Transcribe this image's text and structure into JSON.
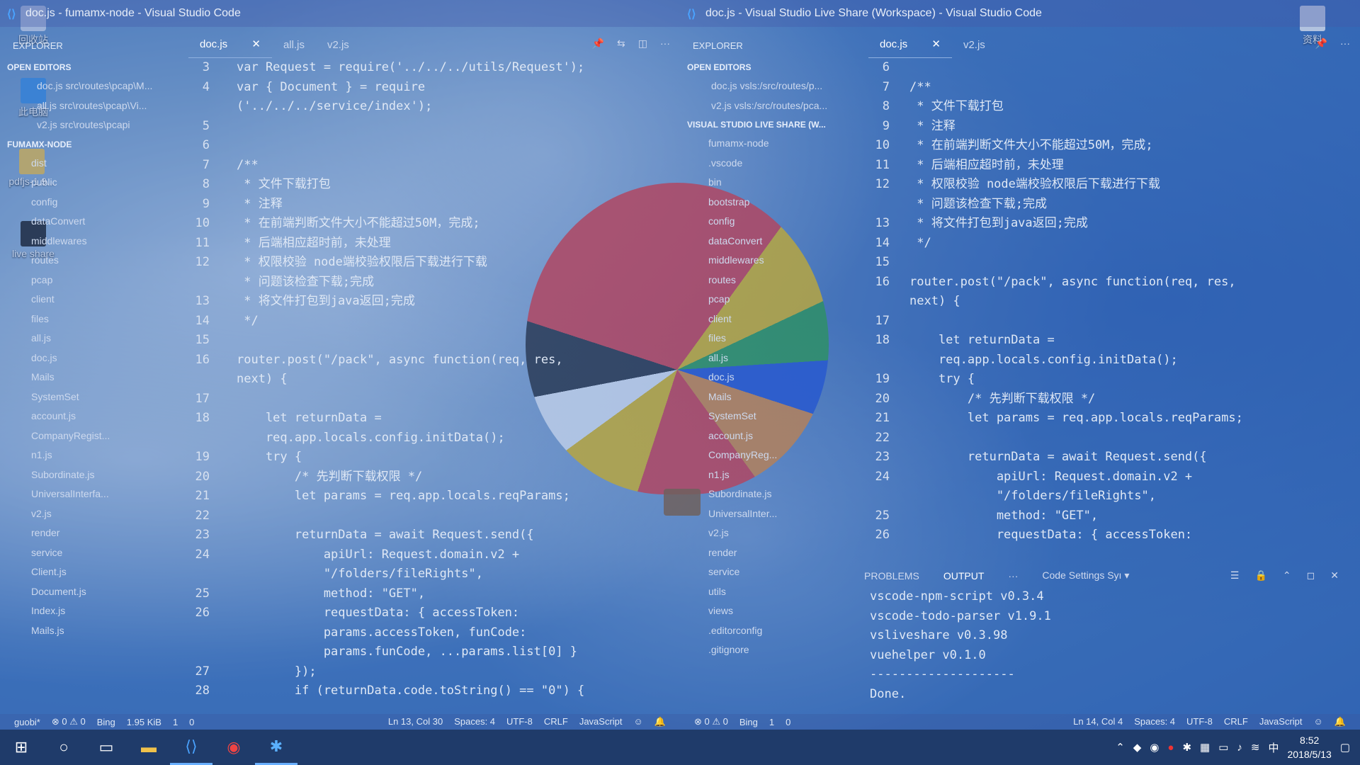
{
  "left_window": {
    "title": "doc.js - fumamx-node - Visual Studio Code",
    "tabs": [
      "doc.js",
      "all.js",
      "v2.js"
    ],
    "explorer_title": "EXPLORER",
    "sections": {
      "open": "OPEN EDITORS",
      "root": "FUMAMX-NODE"
    },
    "open_editors": [
      "doc.js src\\routes\\pcap\\M...",
      "all.js src\\routes\\pcap\\Vi...",
      "v2.js src\\routes\\pcapi"
    ],
    "tree": [
      "dist",
      "public",
      "config",
      "dataConvert",
      "middlewares",
      "routes",
      "pcap",
      "client",
      "files",
      "all.js",
      "doc.js",
      "Mails",
      "SystemSet",
      "account.js",
      "CompanyRegist...",
      "n1.js",
      "Subordinate.js",
      "UniversalInterfa...",
      "v2.js",
      "render",
      "service",
      "Client.js",
      "Document.js",
      "Index.js",
      "Mails.js"
    ],
    "line_numbers": [
      "3",
      "4",
      "",
      "5",
      "6",
      "7",
      "8",
      "9",
      "10",
      "11",
      "12",
      "",
      "13",
      "14",
      "15",
      "16",
      "",
      "17",
      "18",
      "",
      "19",
      "20",
      "21",
      "22",
      "23",
      "24",
      "",
      "25",
      "26",
      "",
      "",
      "27",
      "28"
    ],
    "code": [
      "var Request = require('../../../utils/Request');",
      "var { Document } = require",
      "('../../../service/index');",
      "",
      "",
      "/**",
      " * 文件下载打包",
      " * 注释",
      " * 在前端判断文件大小不能超过50M，完成;",
      " * 后端相应超时前，未处理",
      " * 权限校验 node端校验权限后下载进行下载",
      " * 问题该检查下载;完成",
      " * 将文件打包到java返回;完成",
      " */",
      "",
      "router.post(\"/pack\", async function(req, res,",
      "next) {",
      "",
      "    let returnData =",
      "    req.app.locals.config.initData();",
      "    try {",
      "        /* 先判断下载权限 */",
      "        let params = req.app.locals.reqParams;",
      "",
      "        returnData = await Request.send({",
      "            apiUrl: Request.domain.v2 +",
      "            \"/folders/fileRights\",",
      "            method: \"GET\",",
      "            requestData: { accessToken:",
      "            params.accessToken, funCode:",
      "            params.funCode, ...params.list[0] }",
      "        });",
      "        if (returnData.code.toString() == \"0\") {"
    ],
    "status": {
      "branch": "guobi*",
      "errors": "0",
      "warnings": "0",
      "bing": "Bing",
      "size": "1.95 KiB",
      "num": "1",
      "zero": "0",
      "pos": "Ln 13, Col 30",
      "spaces": "Spaces: 4",
      "enc": "UTF-8",
      "eol": "CRLF",
      "lang": "JavaScript"
    }
  },
  "right_window": {
    "title": "doc.js - Visual Studio Live Share (Workspace) - Visual Studio Code",
    "tabs": [
      "doc.js",
      "v2.js"
    ],
    "explorer_title": "EXPLORER",
    "sections": {
      "open": "OPEN EDITORS",
      "root": "VISUAL STUDIO LIVE SHARE (W..."
    },
    "open_editors": [
      "doc.js vsls:/src/routes/p...",
      "v2.js vsls:/src/routes/pca..."
    ],
    "tree": [
      "fumamx-node",
      ".vscode",
      "bin",
      "bootstrap",
      "config",
      "dataConvert",
      "middlewares",
      "routes",
      "pcap",
      "client",
      "files",
      "all.js",
      "doc.js",
      "Mails",
      "SystemSet",
      "account.js",
      "CompanyReg...",
      "n1.js",
      "Subordinate.js",
      "UniversalInter...",
      "v2.js",
      "render",
      "service",
      "utils",
      "views",
      ".editorconfig",
      ".gitignore"
    ],
    "line_numbers": [
      "6",
      "7",
      "8",
      "9",
      "10",
      "11",
      "12",
      "",
      "13",
      "14",
      "15",
      "16",
      "",
      "17",
      "18",
      "",
      "19",
      "20",
      "21",
      "22",
      "23",
      "24",
      "",
      "25",
      "26"
    ],
    "code": [
      "",
      "/**",
      " * 文件下载打包",
      " * 注释",
      " * 在前端判断文件大小不能超过50M，完成;",
      " * 后端相应超时前，未处理",
      " * 权限校验 node端校验权限后下载进行下载",
      " * 问题该检查下载;完成",
      " * 将文件打包到java返回;完成",
      " */",
      "",
      "router.post(\"/pack\", async function(req, res,",
      "next) {",
      "",
      "    let returnData =",
      "    req.app.locals.config.initData();",
      "    try {",
      "        /* 先判断下载权限 */",
      "        let params = req.app.locals.reqParams;",
      "",
      "        returnData = await Request.send({",
      "            apiUrl: Request.domain.v2 +",
      "            \"/folders/fileRights\",",
      "            method: \"GET\",",
      "            requestData: { accessToken:"
    ],
    "panel": {
      "tabs": [
        "PROBLEMS",
        "OUTPUT"
      ],
      "more": "···",
      "select": "Code Settings Syı ▾",
      "lines": [
        "vscode-npm-script v0.3.4",
        "vscode-todo-parser v1.9.1",
        "vsliveshare v0.3.98",
        "vuehelper v0.1.0",
        "--------------------",
        "Done."
      ]
    },
    "status": {
      "errors": "0",
      "warnings": "0",
      "bing": "Bing",
      "num": "1",
      "zero": "0",
      "pos": "Ln 14, Col 4",
      "spaces": "Spaces: 4",
      "enc": "UTF-8",
      "eol": "CRLF",
      "lang": "JavaScript"
    }
  },
  "desktop": {
    "recycle": "回收站",
    "computer": "此电脑",
    "pdfjs": "pdfjs-1.9...",
    "liveshare": "live share",
    "docs": "资料"
  },
  "taskbar": {
    "time": "8:52",
    "date": "2018/5/13",
    "ime": "中"
  }
}
